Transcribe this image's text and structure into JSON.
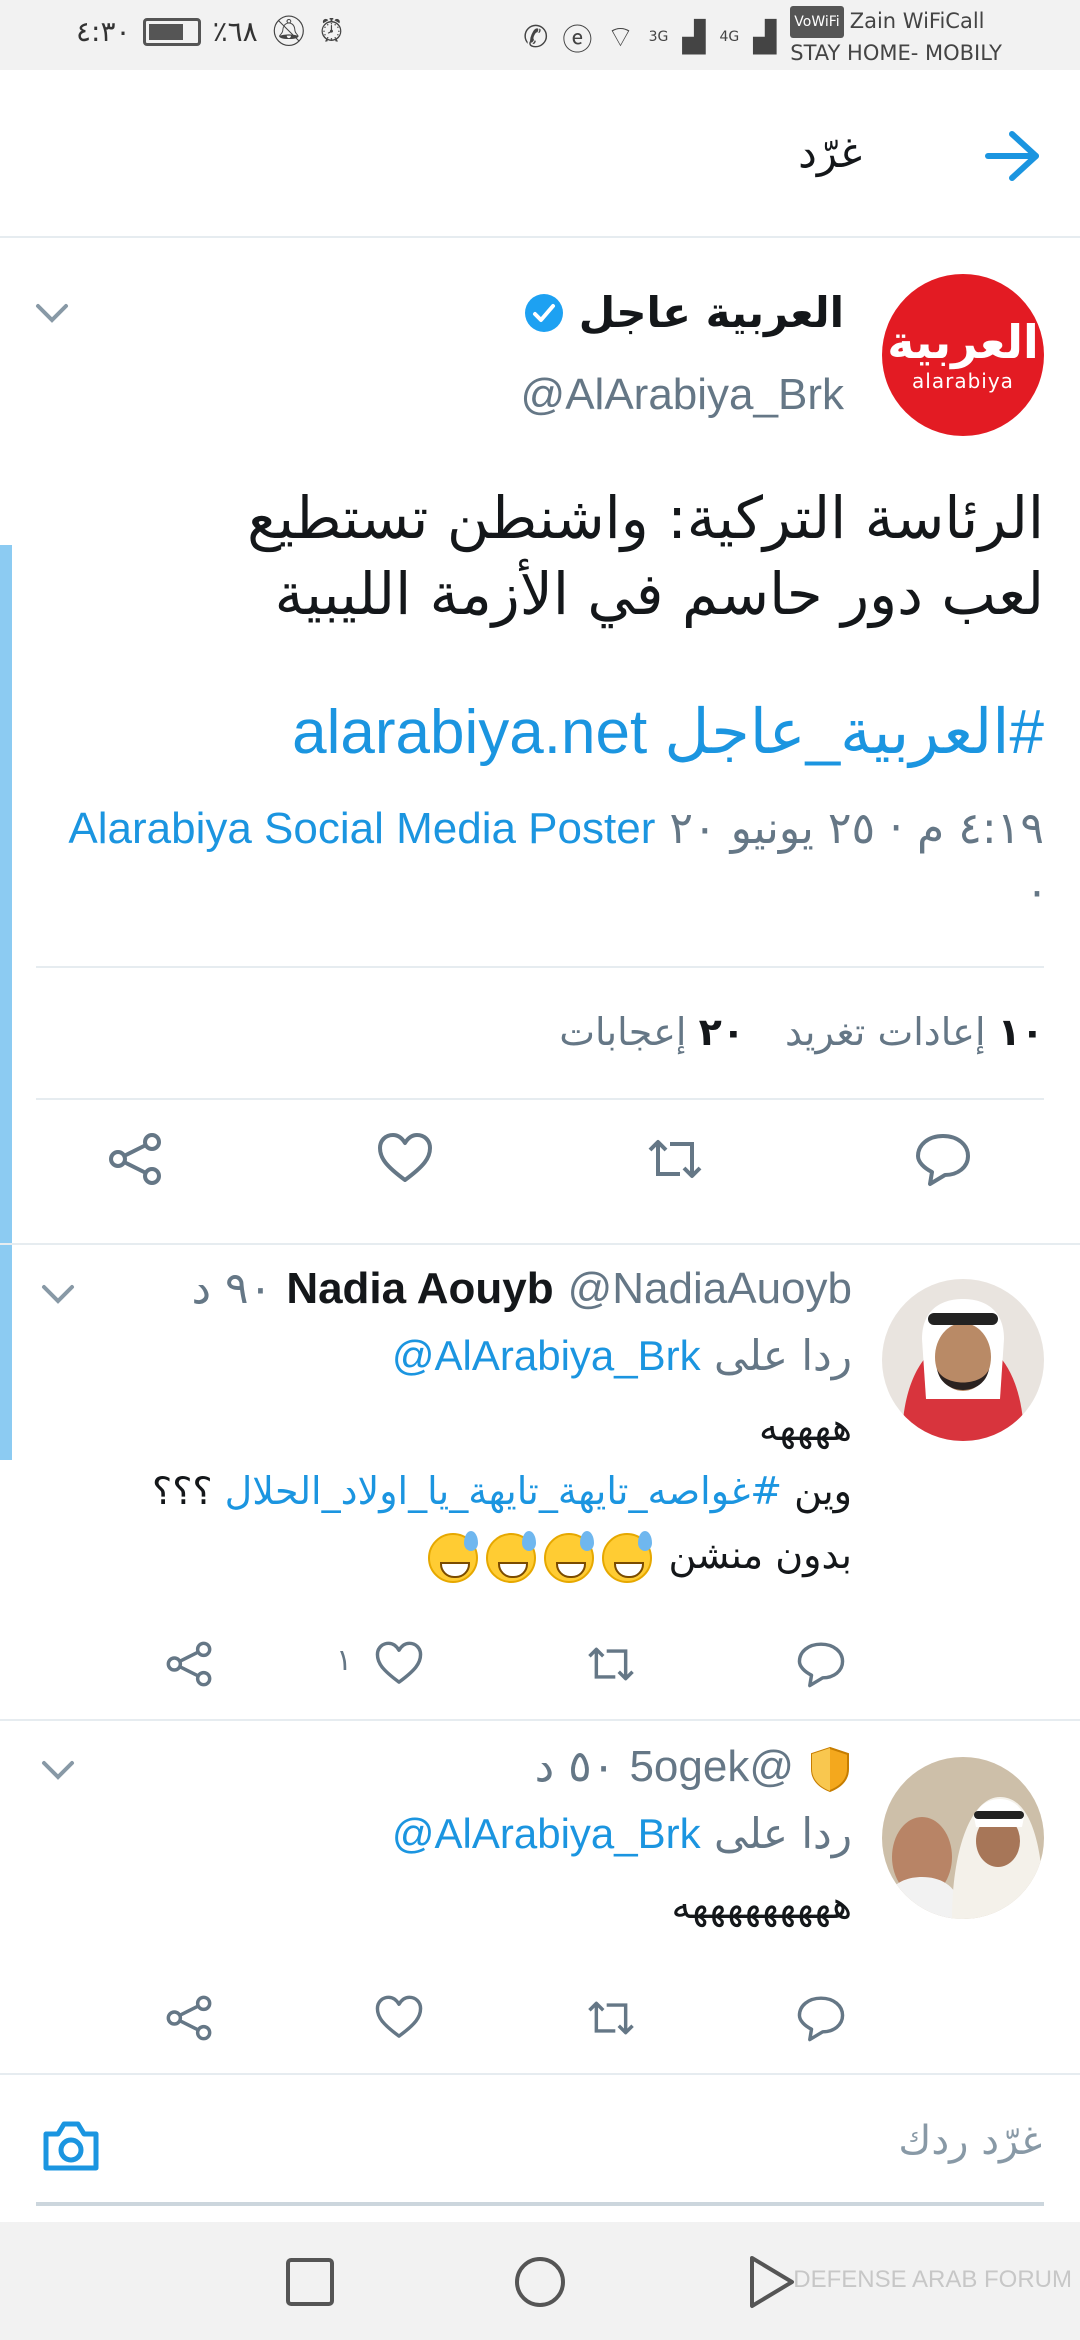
{
  "status_bar": {
    "time": "٤:٣٠",
    "battery": "٪٦٨",
    "vowifi": "VoWiFi",
    "carrier_line1": "Zain WiFiCall",
    "carrier_line2": "STAY HOME- MOBILY",
    "signal1": "3G",
    "signal2": "4G"
  },
  "header": {
    "title": "غرّد"
  },
  "main_tweet": {
    "avatar_text_ar": "العربية",
    "avatar_text_en": "alarabiya",
    "name": "العربية عاجل",
    "handle": "@AlArabiya_Brk",
    "text_line1": "الرئاسة التركية: واشنطن تستطيع",
    "text_line2": "لعب دور حاسم في الأزمة الليبية",
    "link": "alarabiya.net",
    "hashtag": "#العربية_عاجل",
    "time": "٤:١٩ م · ٢٥ يونيو ٢٠ ·",
    "source": "Alarabiya Social Media Poster",
    "retweets_count": "١٠",
    "retweets_label": "إعادات تغريد",
    "likes_count": "٢٠",
    "likes_label": "إعجابات"
  },
  "replies": [
    {
      "name": "Nadia Aouyb",
      "handle": "@NadiaAuoyb",
      "time": "٩٠ د",
      "reply_to_label": "ردا على",
      "reply_to_handle": "@AlArabiya_Brk",
      "line1": "ههههه",
      "line2_prefix": "وين",
      "line2_hashtag": "#غواصه_تايهة_تايهة_يا_اولاد_الحلال",
      "line2_suffix": "؟؟؟",
      "line3": "بدون منشن",
      "like_count": "١"
    },
    {
      "name": "",
      "handle": "@5ogek",
      "time": "٥٠ د",
      "reply_to_label": "ردا على",
      "reply_to_handle": "@AlArabiya_Brk",
      "line1": "هههههههههه"
    }
  ],
  "compose": {
    "placeholder": "غرّد ردك"
  },
  "watermark": "DEFENSE ARAB FORUM",
  "colors": {
    "accent": "#1b95e0",
    "brand_red": "#e31b23",
    "muted": "#657786"
  }
}
